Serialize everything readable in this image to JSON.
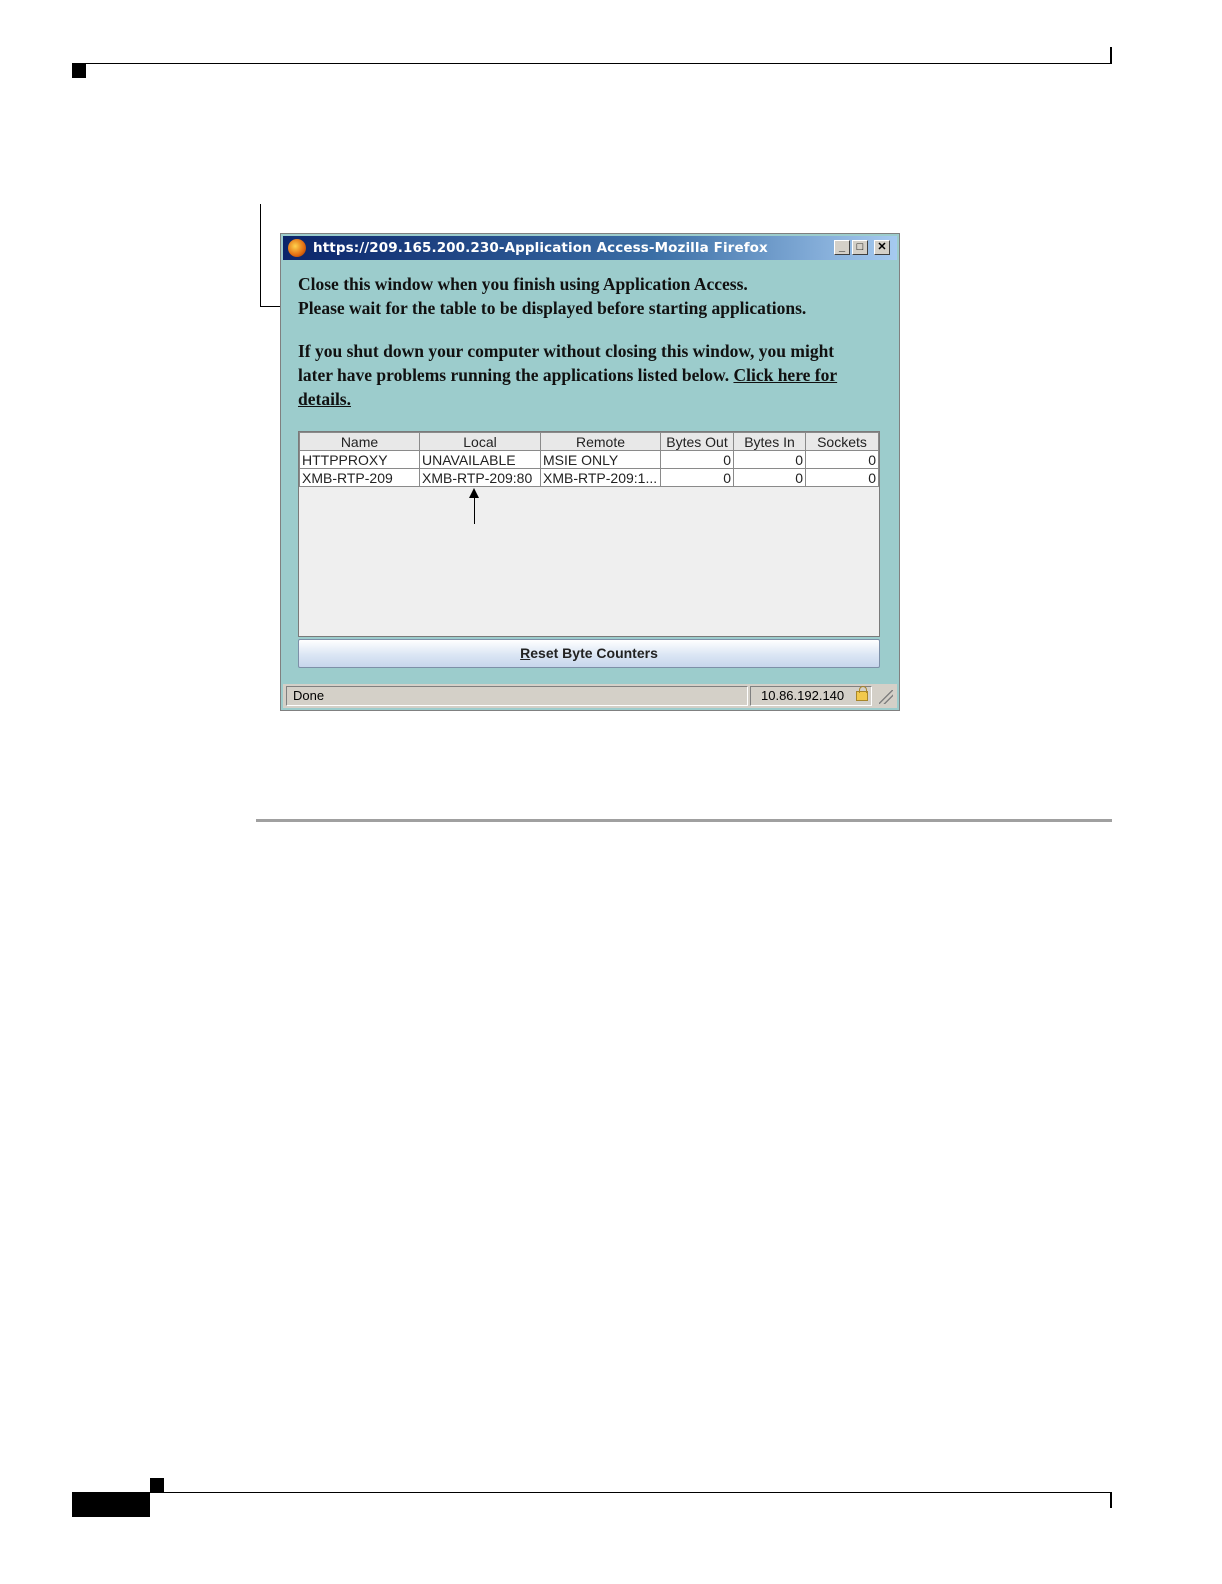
{
  "window": {
    "title": "https://209.165.200.230-Application Access-Mozilla Firefox",
    "controls": {
      "minimize": "_",
      "maximize": "□",
      "close": "✕"
    }
  },
  "messages": {
    "line1": "Close this window when you finish using Application Access.",
    "line2": "Please wait for the table to be displayed before starting applications.",
    "line3": "If you shut down your computer without closing this window, you might",
    "line4_text": "later have problems running the applications listed below.",
    "line4_link": "Click here for",
    "line5_link": "details."
  },
  "table": {
    "headers": [
      "Name",
      "Local",
      "Remote",
      "Bytes Out",
      "Bytes In",
      "Sockets"
    ],
    "rows": [
      [
        "HTTPPROXY",
        "UNAVAILABLE",
        "MSIE ONLY",
        "0",
        "0",
        "0"
      ],
      [
        "XMB-RTP-209",
        "XMB-RTP-209:80",
        "XMB-RTP-209:1...",
        "0",
        "0",
        "0"
      ]
    ]
  },
  "reset_button": {
    "label_underlined": "R",
    "label_rest": "eset Byte Counters"
  },
  "statusbar": {
    "status": "Done",
    "ip": "10.86.192.140"
  },
  "icons": {
    "browser": "firefox-icon",
    "lock": "lock-icon",
    "resize": "resize-grip-icon"
  }
}
